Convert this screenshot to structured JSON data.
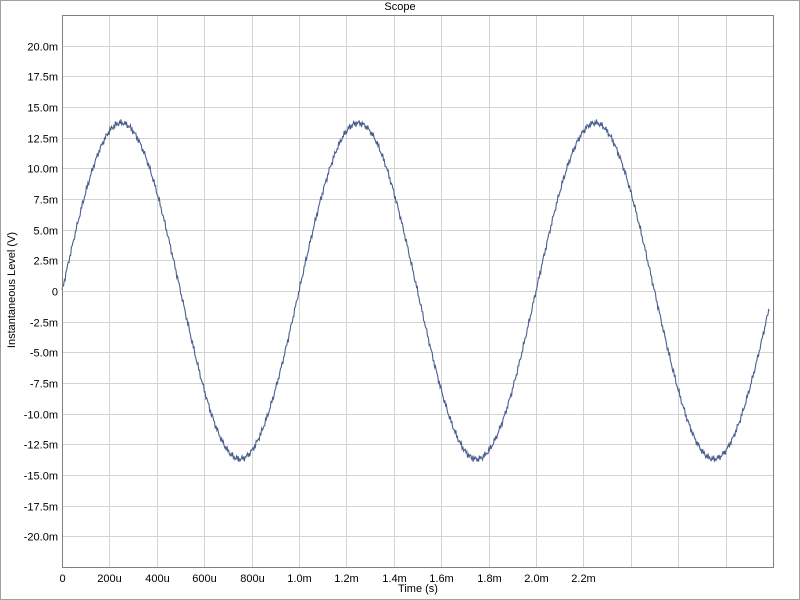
{
  "chart_data": {
    "type": "line",
    "title": "Scope",
    "xlabel": "Time (s)",
    "ylabel": "Instantaneous Level (V)",
    "xlim": [
      0,
      0.003
    ],
    "ylim": [
      -0.0225,
      0.0225
    ],
    "grid": true,
    "legend": "none",
    "x_ticks": [
      {
        "value": 0,
        "label": "0"
      },
      {
        "value": 0.0002,
        "label": "200u"
      },
      {
        "value": 0.0004,
        "label": "400u"
      },
      {
        "value": 0.0006,
        "label": "600u"
      },
      {
        "value": 0.0008,
        "label": "800u"
      },
      {
        "value": 0.001,
        "label": "1.0m"
      },
      {
        "value": 0.0012,
        "label": "1.2m"
      },
      {
        "value": 0.0014,
        "label": "1.4m"
      },
      {
        "value": 0.0016,
        "label": "1.6m"
      },
      {
        "value": 0.0018,
        "label": "1.8m"
      },
      {
        "value": 0.002,
        "label": "2.0m"
      },
      {
        "value": 0.0022,
        "label": "2.2m"
      },
      {
        "value": 0.0024,
        "label": ""
      },
      {
        "value": 0.0026,
        "label": ""
      },
      {
        "value": 0.0028,
        "label": ""
      }
    ],
    "y_ticks": [
      {
        "value": 0.02,
        "label": "20.0m"
      },
      {
        "value": 0.0175,
        "label": "17.5m"
      },
      {
        "value": 0.015,
        "label": "15.0m"
      },
      {
        "value": 0.0125,
        "label": "12.5m"
      },
      {
        "value": 0.01,
        "label": "10.0m"
      },
      {
        "value": 0.0075,
        "label": "7.5m"
      },
      {
        "value": 0.005,
        "label": "5.0m"
      },
      {
        "value": 0.0025,
        "label": "2.5m"
      },
      {
        "value": 0,
        "label": "0"
      },
      {
        "value": -0.0025,
        "label": "-2.5m"
      },
      {
        "value": -0.005,
        "label": "-5.0m"
      },
      {
        "value": -0.0075,
        "label": "-7.5m"
      },
      {
        "value": -0.01,
        "label": "-10.0m"
      },
      {
        "value": -0.0125,
        "label": "-12.5m"
      },
      {
        "value": -0.015,
        "label": "-15.0m"
      },
      {
        "value": -0.0175,
        "label": "-17.5m"
      },
      {
        "value": -0.02,
        "label": "-20.0m"
      }
    ],
    "series": [
      {
        "signal": "sine",
        "amplitude": 0.0137,
        "frequency_hz": 1000,
        "noise_amplitude": 0.0003,
        "t_start": 0,
        "t_end": 0.002985,
        "color": "#4a5f8e"
      }
    ]
  }
}
